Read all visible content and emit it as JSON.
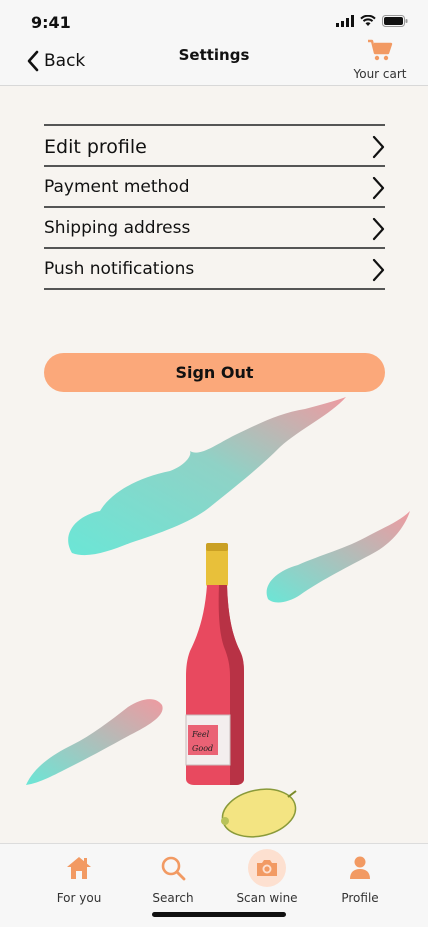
{
  "status": {
    "time": "9:41"
  },
  "nav": {
    "back_label": "Back",
    "title": "Settings",
    "cart_label": "Your cart"
  },
  "settings": [
    {
      "label": "Edit profile"
    },
    {
      "label": "Payment method"
    },
    {
      "label": "Shipping address"
    },
    {
      "label": "Push notifications"
    }
  ],
  "actions": {
    "sign_out_label": "Sign Out"
  },
  "illustration": {
    "bottle_label_line1": "Feel",
    "bottle_label_line2": "Good"
  },
  "tabs": [
    {
      "label": "For you",
      "icon": "home-icon"
    },
    {
      "label": "Search",
      "icon": "search-icon"
    },
    {
      "label": "Scan wine",
      "icon": "camera-icon"
    },
    {
      "label": "Profile",
      "icon": "person-icon"
    }
  ],
  "colors": {
    "accent": "#fba87a",
    "icon_orange": "#f29a63",
    "background": "#f7f4f0",
    "bottle": "#e8495f",
    "mint": "#6be6d6",
    "pink": "#e99aa0"
  }
}
